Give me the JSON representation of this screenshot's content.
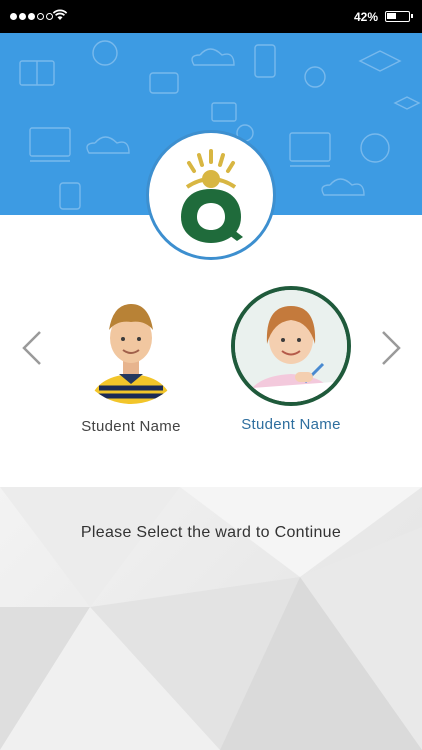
{
  "status_bar": {
    "signal_dots": [
      true,
      true,
      true,
      false,
      false
    ],
    "battery_percent": "42%",
    "battery_level": 0.42
  },
  "header": {
    "banner_color": "#3d9be3",
    "logo_icon": "school-logo-icon"
  },
  "students": [
    {
      "name": "Student Name",
      "selected": false,
      "avatar": "boy-photo"
    },
    {
      "name": "Student Name",
      "selected": true,
      "avatar": "girl-photo"
    }
  ],
  "nav": {
    "prev_icon": "chevron-left-icon",
    "next_icon": "chevron-right-icon"
  },
  "prompt": "Please Select the ward to Continue",
  "colors": {
    "selected_name": "#2f6f9f",
    "selected_ring": "#1f5a3b",
    "logo_ring": "#3d8fcf"
  }
}
